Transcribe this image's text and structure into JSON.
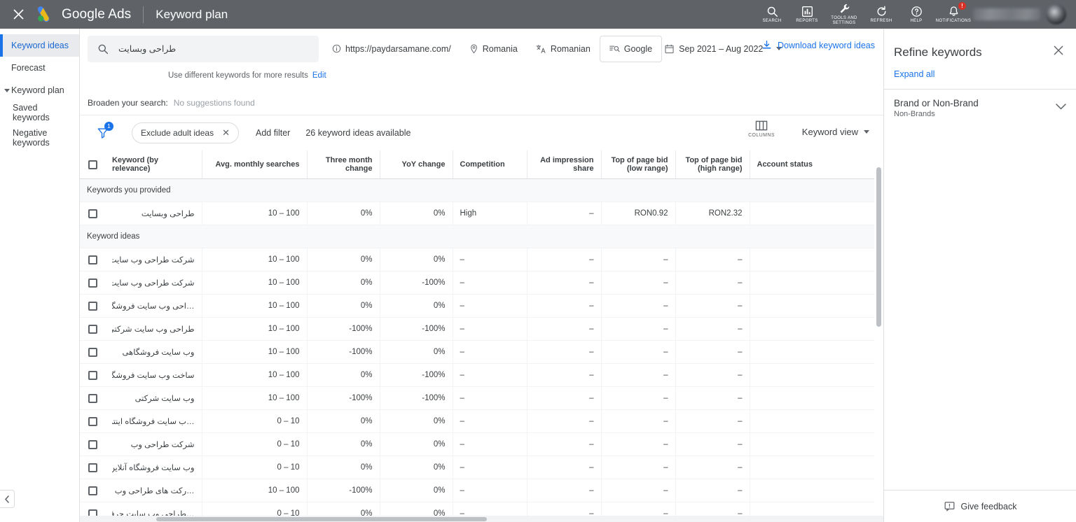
{
  "topbar": {
    "close_icon": "close-icon",
    "brand": "Google Ads",
    "section": "Keyword plan",
    "actions": [
      {
        "label": "SEARCH",
        "icon": "search-icon"
      },
      {
        "label": "REPORTS",
        "icon": "reports-icon"
      },
      {
        "label": "TOOLS AND\nSETTINGS",
        "icon": "wrench-icon"
      },
      {
        "label": "REFRESH",
        "icon": "refresh-icon"
      },
      {
        "label": "HELP",
        "icon": "help-icon"
      },
      {
        "label": "NOTIFICATIONS",
        "icon": "bell-icon",
        "badge": "!"
      }
    ]
  },
  "sidebar": {
    "items": [
      {
        "label": "Keyword ideas",
        "active": true
      },
      {
        "label": "Forecast",
        "active": false
      },
      {
        "label": "Keyword plan",
        "active": false,
        "group": true
      },
      {
        "label": "Saved keywords",
        "active": false,
        "child": true
      },
      {
        "label": "Negative keywords",
        "active": false,
        "child": true
      }
    ]
  },
  "search": {
    "keyword": "طراحی وبسایت",
    "url": "https://paydarsamane.com/",
    "location": "Romania",
    "language": "Romanian",
    "network": "Google",
    "date_range": "Sep 2021 – Aug 2022",
    "hint": "Use different keywords for more results",
    "hint_edit": "Edit",
    "download": "Download keyword ideas"
  },
  "broaden": {
    "label": "Broaden your search:",
    "value": "No suggestions found"
  },
  "filters": {
    "filter_count": "1",
    "chip": "Exclude adult ideas",
    "add_filter": "Add filter",
    "available": "26 keyword ideas available",
    "columns_label": "COLUMNS",
    "view_label": "Keyword view"
  },
  "table": {
    "headers": [
      "Keyword (by relevance)",
      "Avg. monthly searches",
      "Three month change",
      "YoY change",
      "Competition",
      "Ad impression share",
      "Top of page bid (low range)",
      "Top of page bid (high range)",
      "Account status"
    ],
    "sections": [
      {
        "title": "Keywords you provided"
      },
      {
        "title": "Keyword ideas"
      }
    ],
    "provided_rows": [
      {
        "keyword": "طراحی وبسایت",
        "avg": "10 – 100",
        "three_month": "0%",
        "yoy": "0%",
        "competition": "High",
        "ad_share": "–",
        "bid_low": "RON0.92",
        "bid_high": "RON2.32",
        "account": ""
      }
    ],
    "idea_rows": [
      {
        "keyword": "شرکت طراحی وب سایت …",
        "avg": "10 – 100",
        "three_month": "0%",
        "yoy": "0%",
        "competition": "–",
        "ad_share": "–",
        "bid_low": "–",
        "bid_high": "–",
        "account": ""
      },
      {
        "keyword": "شرکت طراحی وب سایت",
        "avg": "10 – 100",
        "three_month": "0%",
        "yoy": "-100%",
        "competition": "–",
        "ad_share": "–",
        "bid_low": "–",
        "bid_high": "–",
        "account": ""
      },
      {
        "keyword": "…احی وب سایت فروشگاهی",
        "avg": "10 – 100",
        "three_month": "0%",
        "yoy": "0%",
        "competition": "–",
        "ad_share": "–",
        "bid_low": "–",
        "bid_high": "–",
        "account": ""
      },
      {
        "keyword": "طراحی وب سایت شرکتی",
        "avg": "10 – 100",
        "three_month": "-100%",
        "yoy": "-100%",
        "competition": "–",
        "ad_share": "–",
        "bid_low": "–",
        "bid_high": "–",
        "account": ""
      },
      {
        "keyword": "وب سایت فروشگاهی",
        "avg": "10 – 100",
        "three_month": "-100%",
        "yoy": "0%",
        "competition": "–",
        "ad_share": "–",
        "bid_low": "–",
        "bid_high": "–",
        "account": ""
      },
      {
        "keyword": "ساخت وب سایت فروشگاهی",
        "avg": "10 – 100",
        "three_month": "0%",
        "yoy": "-100%",
        "competition": "–",
        "ad_share": "–",
        "bid_low": "–",
        "bid_high": "–",
        "account": ""
      },
      {
        "keyword": "وب سایت شرکتی",
        "avg": "10 – 100",
        "three_month": "-100%",
        "yoy": "-100%",
        "competition": "–",
        "ad_share": "–",
        "bid_low": "–",
        "bid_high": "–",
        "account": ""
      },
      {
        "keyword": "…ب سایت فروشگاه اینترنتی",
        "avg": "0 – 10",
        "three_month": "0%",
        "yoy": "0%",
        "competition": "–",
        "ad_share": "–",
        "bid_low": "–",
        "bid_high": "–",
        "account": ""
      },
      {
        "keyword": "شرکت طراحی وب",
        "avg": "0 – 10",
        "three_month": "0%",
        "yoy": "0%",
        "competition": "–",
        "ad_share": "–",
        "bid_low": "–",
        "bid_high": "–",
        "account": ""
      },
      {
        "keyword": "وب سایت فروشگاه آنلاین …",
        "avg": "0 – 10",
        "three_month": "0%",
        "yoy": "0%",
        "competition": "–",
        "ad_share": "–",
        "bid_low": "–",
        "bid_high": "–",
        "account": ""
      },
      {
        "keyword": "…رکت های طراحی وب سایت",
        "avg": "10 – 100",
        "three_month": "-100%",
        "yoy": "0%",
        "competition": "–",
        "ad_share": "–",
        "bid_low": "–",
        "bid_high": "–",
        "account": ""
      },
      {
        "keyword": "…طراحی وب سایت حرفه ای",
        "avg": "0 – 10",
        "three_month": "0%",
        "yoy": "0%",
        "competition": "–",
        "ad_share": "–",
        "bid_low": "–",
        "bid_high": "–",
        "account": ""
      }
    ]
  },
  "refine": {
    "title": "Refine keywords",
    "expand_all": "Expand all",
    "groups": [
      {
        "title": "Brand or Non-Brand",
        "subtitle": "Non-Brands"
      }
    ],
    "feedback": "Give feedback"
  },
  "colors": {
    "topbar_bg": "#5f6368",
    "accent_blue": "#1a73e8",
    "link_blue": "#1967d2",
    "text": "#3c4043",
    "muted": "#5f6368",
    "badge_red": "#d93025"
  }
}
